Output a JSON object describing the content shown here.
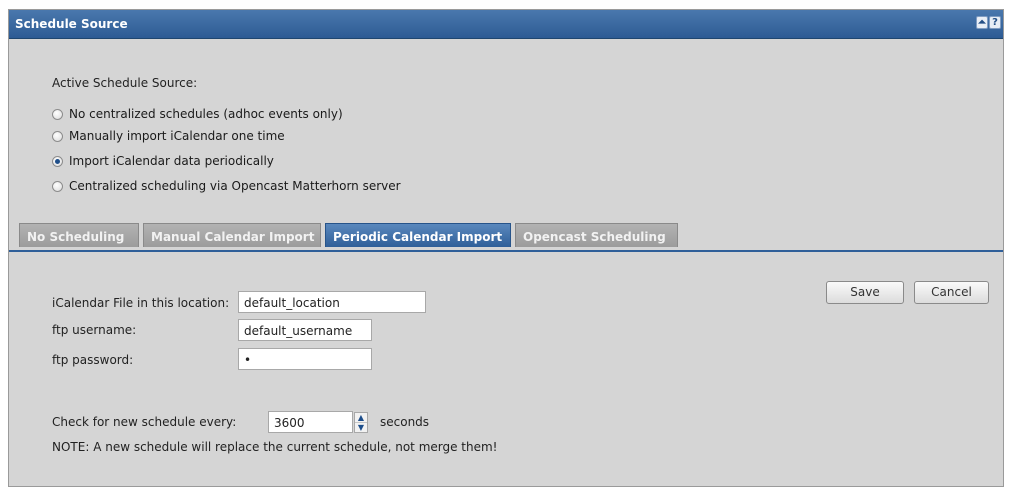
{
  "panel": {
    "title": "Schedule Source",
    "collapse_glyph": "⏶",
    "help_glyph": "?"
  },
  "source": {
    "heading": "Active Schedule Source:",
    "options": [
      {
        "label": "No centralized schedules (adhoc events only)",
        "checked": false
      },
      {
        "label": "Manually import iCalendar one time",
        "checked": false
      },
      {
        "label": "Import iCalendar data periodically",
        "checked": true
      },
      {
        "label": "Centralized scheduling via Opencast Matterhorn server",
        "checked": false
      }
    ]
  },
  "tabs": [
    {
      "label": "No Scheduling",
      "active": false
    },
    {
      "label": "Manual Calendar Import",
      "active": false
    },
    {
      "label": "Periodic Calendar Import",
      "active": true
    },
    {
      "label": "Opencast Scheduling",
      "active": false
    }
  ],
  "form": {
    "location_label": "iCalendar File in this location:",
    "location_value": "default_location",
    "username_label": "ftp username:",
    "username_value": "default_username",
    "password_label": "ftp password:",
    "password_value": "•",
    "interval_label": "Check for new schedule every:",
    "interval_value": "3600",
    "interval_unit": "seconds",
    "note": "NOTE: A new schedule will replace the current schedule, not merge them!"
  },
  "actions": {
    "save_label": "Save",
    "cancel_label": "Cancel"
  },
  "spinner": {
    "up_glyph": "▲",
    "down_glyph": "▼"
  }
}
